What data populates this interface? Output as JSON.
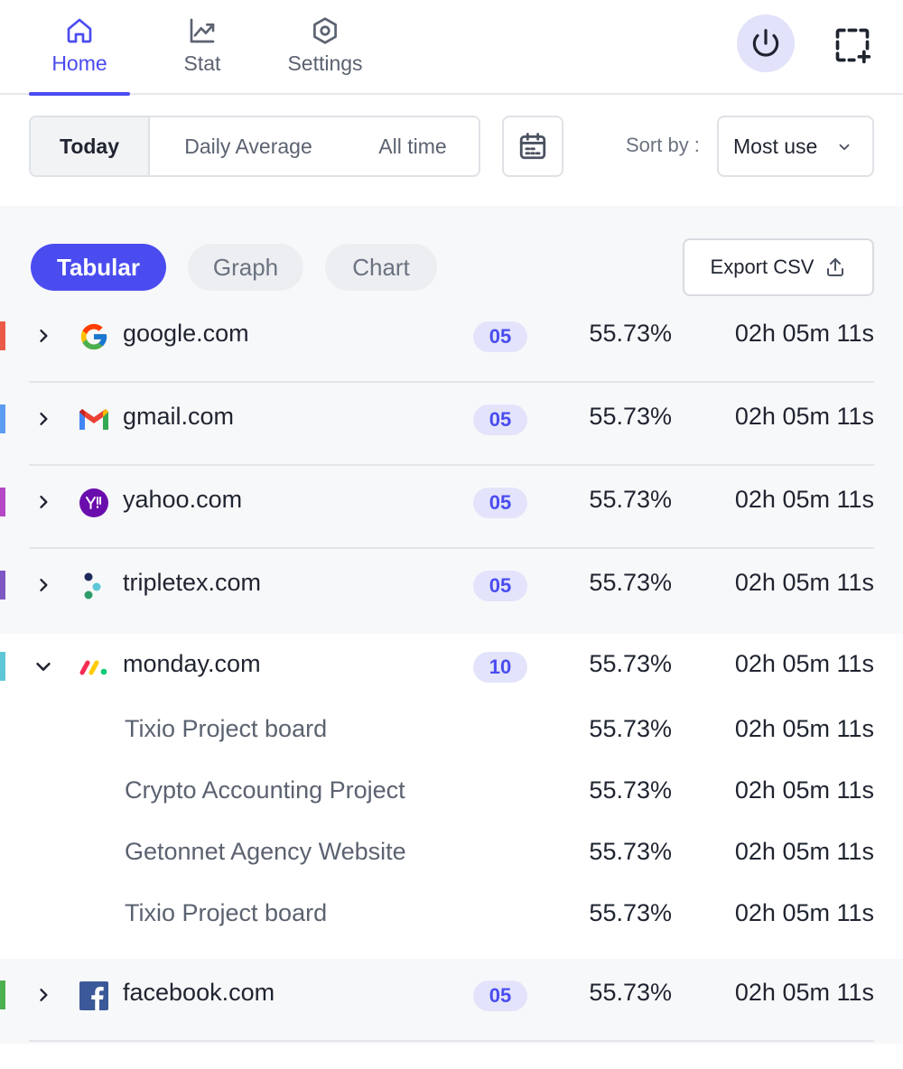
{
  "nav": {
    "tabs": [
      {
        "label": "Home",
        "icon": "home-icon",
        "active": true
      },
      {
        "label": "Stat",
        "icon": "chart-line-icon",
        "active": false
      },
      {
        "label": "Settings",
        "icon": "settings-hexagon-icon",
        "active": false
      }
    ],
    "power_icon": "power-icon",
    "capture_icon": "screenshot-add-icon"
  },
  "filters": {
    "periods": [
      "Today",
      "Daily Average",
      "All time"
    ],
    "selected_period": "Today",
    "calendar_icon": "calendar-icon",
    "sort_label": "Sort by :",
    "sort_value": "Most use"
  },
  "views": {
    "tabs": [
      "Tabular",
      "Graph",
      "Chart"
    ],
    "selected": "Tabular",
    "export_label": "Export CSV",
    "export_icon": "upload-icon"
  },
  "colors": {
    "accent": "#4a4cf0",
    "badge_bg": "#e3e3fb"
  },
  "rows": [
    {
      "site": "google.com",
      "count": "05",
      "percent": "55.73%",
      "duration": "02h 05m 11s",
      "color": "#ea5a47",
      "icon": "google-icon",
      "expanded": false
    },
    {
      "site": "gmail.com",
      "count": "05",
      "percent": "55.73%",
      "duration": "02h 05m 11s",
      "color": "#5c9df0",
      "icon": "gmail-icon",
      "expanded": false
    },
    {
      "site": "yahoo.com",
      "count": "05",
      "percent": "55.73%",
      "duration": "02h 05m 11s",
      "color": "#b548c6",
      "icon": "yahoo-icon",
      "expanded": false
    },
    {
      "site": "tripletex.com",
      "count": "05",
      "percent": "55.73%",
      "duration": "02h 05m 11s",
      "color": "#7e57c2",
      "icon": "tripletex-icon",
      "expanded": false
    },
    {
      "site": "monday.com",
      "count": "10",
      "percent": "55.73%",
      "duration": "02h 05m 11s",
      "color": "#5ec6d6",
      "icon": "monday-icon",
      "expanded": true,
      "children": [
        {
          "name": "Tixio Project board",
          "percent": "55.73%",
          "duration": "02h 05m 11s"
        },
        {
          "name": "Crypto Accounting Project",
          "percent": "55.73%",
          "duration": "02h 05m 11s"
        },
        {
          "name": "Getonnet Agency Website",
          "percent": "55.73%",
          "duration": "02h 05m 11s"
        },
        {
          "name": "Tixio Project board",
          "percent": "55.73%",
          "duration": "02h 05m 11s"
        }
      ]
    },
    {
      "site": "facebook.com",
      "count": "05",
      "percent": "55.73%",
      "duration": "02h 05m 11s",
      "color": "#4caf50",
      "icon": "facebook-icon",
      "expanded": false
    }
  ]
}
